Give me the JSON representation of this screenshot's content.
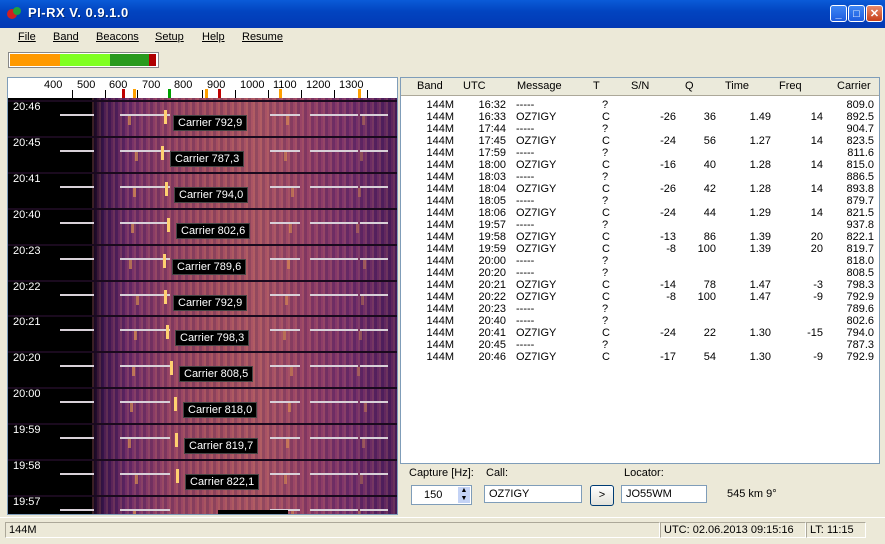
{
  "window": {
    "title": "PI-RX  V.  0.9.1.0",
    "min": "_",
    "max": "□",
    "close": "✕"
  },
  "menu": [
    "File",
    "Band",
    "Beacons",
    "Setup",
    "Help",
    "Resume"
  ],
  "meter": {
    "orange": 0.34,
    "lightgreen": 0.34,
    "darkgreen": 0.27,
    "red": 0.05,
    "colors": [
      "#ff9900",
      "#80ff20",
      "#2a9a1e",
      "#b00000"
    ]
  },
  "waterfall": {
    "ruler_ticks": [
      "400",
      "500",
      "600",
      "700",
      "800",
      "900",
      "1000",
      "1100",
      "1200",
      "1300"
    ],
    "rows": [
      {
        "time": "20:46",
        "carrier": "Carrier 792,9"
      },
      {
        "time": "20:45",
        "carrier": "Carrier 787,3"
      },
      {
        "time": "20:41",
        "carrier": "Carrier 794,0"
      },
      {
        "time": "20:40",
        "carrier": "Carrier 802,6"
      },
      {
        "time": "20:23",
        "carrier": "Carrier 789,6"
      },
      {
        "time": "20:22",
        "carrier": "Carrier 792,9"
      },
      {
        "time": "20:21",
        "carrier": "Carrier 798,3"
      },
      {
        "time": "20:20",
        "carrier": "Carrier 808,5"
      },
      {
        "time": "20:00",
        "carrier": "Carrier 818,0"
      },
      {
        "time": "19:59",
        "carrier": "Carrier 819,7"
      },
      {
        "time": "19:58",
        "carrier": "Carrier 822,1"
      },
      {
        "time": "19:57",
        "carrier": ""
      }
    ]
  },
  "table": {
    "headers": [
      "Band",
      "UTC",
      "Message",
      "T",
      "S/N",
      "Q",
      "Time",
      "Freq",
      "Carrier"
    ],
    "rows": [
      [
        "144M",
        "16:32",
        "-----",
        "?",
        "",
        "",
        "",
        "",
        "809.0"
      ],
      [
        "144M",
        "16:33",
        "OZ7IGY",
        "C",
        "-26",
        "36",
        "1.49",
        "14",
        "892.5"
      ],
      [
        "144M",
        "17:44",
        "-----",
        "?",
        "",
        "",
        "",
        "",
        "904.7"
      ],
      [
        "144M",
        "17:45",
        "OZ7IGY",
        "C",
        "-24",
        "56",
        "1.27",
        "14",
        "823.5"
      ],
      [
        "144M",
        "17:59",
        "-----",
        "?",
        "",
        "",
        "",
        "",
        "811.6"
      ],
      [
        "144M",
        "18:00",
        "OZ7IGY",
        "C",
        "-16",
        "40",
        "1.28",
        "14",
        "815.0"
      ],
      [
        "144M",
        "18:03",
        "-----",
        "?",
        "",
        "",
        "",
        "",
        "886.5"
      ],
      [
        "144M",
        "18:04",
        "OZ7IGY",
        "C",
        "-26",
        "42",
        "1.28",
        "14",
        "893.8"
      ],
      [
        "144M",
        "18:05",
        "-----",
        "?",
        "",
        "",
        "",
        "",
        "879.7"
      ],
      [
        "144M",
        "18:06",
        "OZ7IGY",
        "C",
        "-24",
        "44",
        "1.29",
        "14",
        "821.5"
      ],
      [
        "144M",
        "19:57",
        "-----",
        "?",
        "",
        "",
        "",
        "",
        "937.8"
      ],
      [
        "144M",
        "19:58",
        "OZ7IGY",
        "C",
        "-13",
        "86",
        "1.39",
        "20",
        "822.1"
      ],
      [
        "144M",
        "19:59",
        "OZ7IGY",
        "C",
        "-8",
        "100",
        "1.39",
        "20",
        "819.7"
      ],
      [
        "144M",
        "20:00",
        "-----",
        "?",
        "",
        "",
        "",
        "",
        "818.0"
      ],
      [
        "144M",
        "20:20",
        "-----",
        "?",
        "",
        "",
        "",
        "",
        "808.5"
      ],
      [
        "144M",
        "20:21",
        "OZ7IGY",
        "C",
        "-14",
        "78",
        "1.47",
        "-3",
        "798.3"
      ],
      [
        "144M",
        "20:22",
        "OZ7IGY",
        "C",
        "-8",
        "100",
        "1.47",
        "-9",
        "792.9"
      ],
      [
        "144M",
        "20:23",
        "-----",
        "?",
        "",
        "",
        "",
        "",
        "789.6"
      ],
      [
        "144M",
        "20:40",
        "-----",
        "?",
        "",
        "",
        "",
        "",
        "802.6"
      ],
      [
        "144M",
        "20:41",
        "OZ7IGY",
        "C",
        "-24",
        "22",
        "1.30",
        "-15",
        "794.0"
      ],
      [
        "144M",
        "20:45",
        "-----",
        "?",
        "",
        "",
        "",
        "",
        "787.3"
      ],
      [
        "144M",
        "20:46",
        "OZ7IGY",
        "C",
        "-17",
        "54",
        "1.30",
        "-9",
        "792.9"
      ]
    ]
  },
  "controls": {
    "capture_label": "Capture [Hz]:",
    "capture_value": "150",
    "call_label": "Call:",
    "call_value": "OZ7IGY",
    "go_button": ">",
    "locator_label": "Locator:",
    "locator_value": "JO55WM",
    "distance": "545 km 9°"
  },
  "status": {
    "band": "144M",
    "utc": "UTC:  02.06.2013  09:15:16",
    "lt": "LT:  11:15"
  }
}
